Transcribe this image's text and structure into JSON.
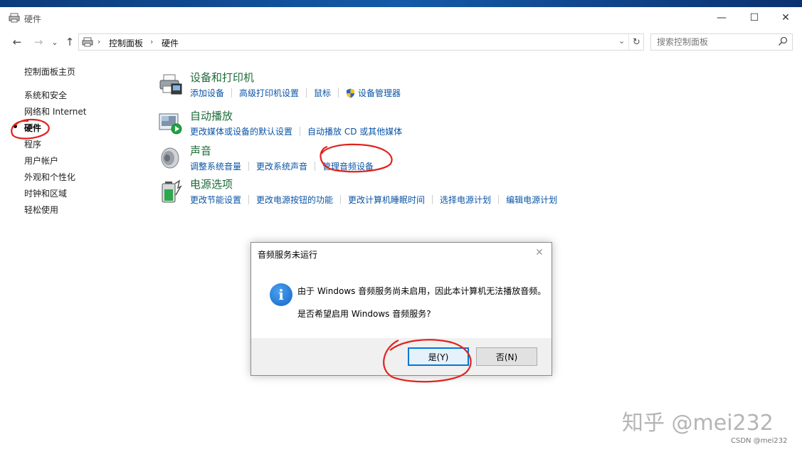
{
  "window": {
    "title": "硬件",
    "controls": {
      "minimize": "—",
      "maximize": "☐",
      "close": "✕"
    }
  },
  "nav": {
    "back": "←",
    "forward": "→",
    "recent": "⌄",
    "up": "↑"
  },
  "address": {
    "breadcrumbs": [
      "控制面板",
      "硬件"
    ],
    "separator": "›",
    "dropdown": "⌄",
    "refresh": "↻"
  },
  "search": {
    "placeholder": "搜索控制面板"
  },
  "sidebar": {
    "items": [
      {
        "label": "控制面板主页"
      },
      {
        "label": "系统和安全"
      },
      {
        "label": "网络和 Internet"
      },
      {
        "label": "硬件"
      },
      {
        "label": "程序"
      },
      {
        "label": "用户帐户"
      },
      {
        "label": "外观和个性化"
      },
      {
        "label": "时钟和区域"
      },
      {
        "label": "轻松使用"
      }
    ]
  },
  "categories": [
    {
      "title": "设备和打印机",
      "icon": "printer-icon",
      "links": [
        "添加设备",
        "高级打印机设置",
        "鼠标",
        "设备管理器"
      ]
    },
    {
      "title": "自动播放",
      "icon": "autoplay-icon",
      "links": [
        "更改媒体或设备的默认设置",
        "自动播放 CD 或其他媒体"
      ]
    },
    {
      "title": "声音",
      "icon": "speaker-icon",
      "links": [
        "调整系统音量",
        "更改系统声音",
        "管理音频设备"
      ]
    },
    {
      "title": "电源选项",
      "icon": "battery-icon",
      "links": [
        "更改节能设置",
        "更改电源按钮的功能",
        "更改计算机睡眠时间",
        "选择电源计划",
        "编辑电源计划"
      ]
    }
  ],
  "dialog": {
    "title": "音频服务未运行",
    "close": "✕",
    "icon_glyph": "i",
    "message1": "由于 Windows 音频服务尚未启用，因此本计算机无法播放音频。",
    "message2": "是否希望启用 Windows 音频服务?",
    "yes": "是(Y)",
    "no": "否(N)"
  },
  "colors": {
    "link": "#0a54a6",
    "category_title": "#1e6b3a",
    "annotation": "#e0231e"
  },
  "watermark": "知乎 @mei232",
  "credit": "CSDN @mei232"
}
